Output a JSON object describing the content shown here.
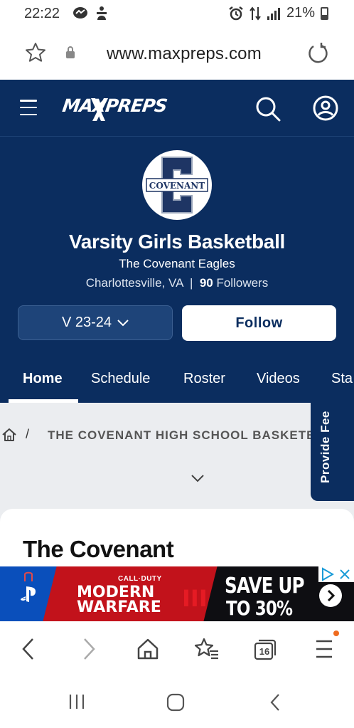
{
  "status_bar": {
    "time": "22:22",
    "battery": "21%",
    "icons": [
      "messenger-icon",
      "accessibility-icon",
      "alarm-icon",
      "data-arrows-icon",
      "signal-icon",
      "battery-icon"
    ]
  },
  "browser": {
    "url": "www.maxpreps.com",
    "tab_count": "16"
  },
  "site_header": {
    "logo": "MAXPREPS"
  },
  "team": {
    "logo_text": "COVENANT",
    "logo_letter": "C",
    "title": "Varsity Girls Basketball",
    "school": "The Covenant Eagles",
    "location": "Charlottesville, VA",
    "separator": "|",
    "followers_count": "90",
    "followers_label": "Followers",
    "season": "V 23-24",
    "follow_label": "Follow"
  },
  "tabs": [
    {
      "label": "Home",
      "active": true
    },
    {
      "label": "Schedule",
      "active": false
    },
    {
      "label": "Roster",
      "active": false
    },
    {
      "label": "Videos",
      "active": false
    },
    {
      "label": "Sta",
      "active": false
    }
  ],
  "breadcrumb": {
    "separator": "/",
    "text": "THE COVENANT HIGH SCHOOL BASKETBALL"
  },
  "feedback": {
    "label": "Provide Fee"
  },
  "card": {
    "title": "The Covenant"
  },
  "ad": {
    "brand_small": "CALL·DUTY",
    "title_line1": "MODERN",
    "title_line2": "WARFARE",
    "title_numeral": "III",
    "offer_line1": "SAVE UP",
    "offer_line2": "TO 30%"
  },
  "colors": {
    "navy": "#0b2d5f",
    "content_bg": "#ebedf0",
    "ad_red": "#c2121b",
    "badge_orange": "#ef6b1e"
  }
}
